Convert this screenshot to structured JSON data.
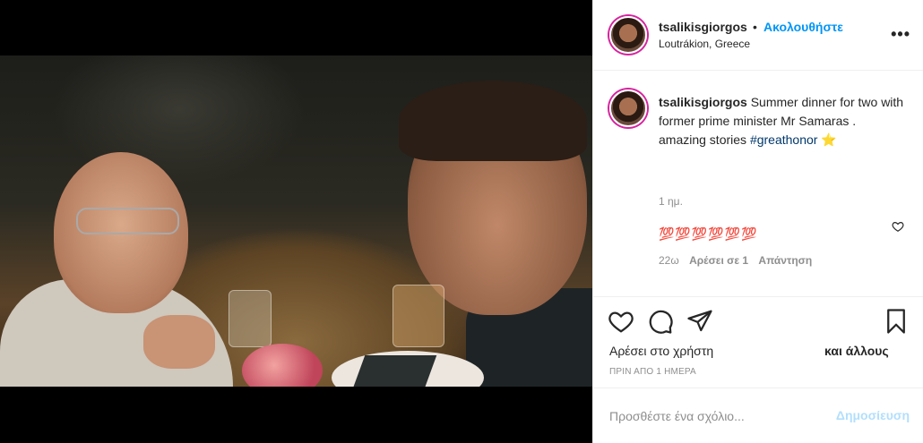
{
  "post": {
    "username": "tsalikisgiorgos",
    "follow_separator": "•",
    "follow_label": "Ακολουθήστε",
    "location": "Loutrákion, Greece",
    "more_label": "•••"
  },
  "caption": {
    "username": "tsalikisgiorgos",
    "text": " Summer dinner for two with former prime minister Mr Samaras .",
    "text2": "amazing stories ",
    "hashtag": "#greathonor",
    "emoji": "⭐",
    "time": "1 ημ."
  },
  "reply": {
    "text": "💯💯💯💯💯💯",
    "time": "22ω",
    "likes": "Αρέσει σε 1",
    "reply_label": "Απάντηση"
  },
  "actions": {
    "like_icon": "heart-icon",
    "comment_icon": "comment-icon",
    "share_icon": "share-icon",
    "save_icon": "bookmark-icon",
    "likes_prefix": "Αρέσει στο χρήστη",
    "likes_suffix": "και άλλους",
    "date": "ΠΡΙΝ ΑΠΟ 1 ΗΜΕΡΑ"
  },
  "comment_box": {
    "placeholder": "Προσθέστε ένα σχόλιο...",
    "post_label": "Δημοσίευση"
  },
  "colors": {
    "accent": "#0095f6",
    "link": "#00376b",
    "muted": "#8e8e8e",
    "post_disabled": "#b2dffc"
  }
}
